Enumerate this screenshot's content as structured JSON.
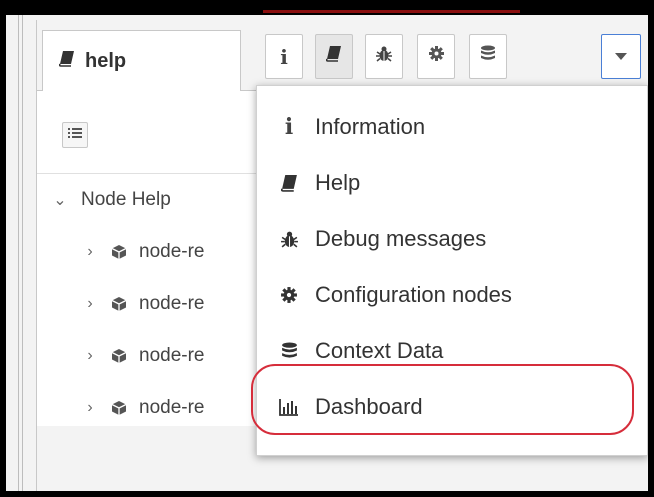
{
  "tabs": {
    "active_label": "help"
  },
  "toolbar": {
    "buttons": [
      {
        "icon": "info-icon"
      },
      {
        "icon": "book-icon"
      },
      {
        "icon": "bug-icon"
      },
      {
        "icon": "gear-icon"
      },
      {
        "icon": "database-icon"
      },
      {
        "icon": "caret-down-icon"
      }
    ]
  },
  "tree": {
    "root_label": "Node Help",
    "items": [
      {
        "label": "node-re"
      },
      {
        "label": "node-re"
      },
      {
        "label": "node-re"
      },
      {
        "label": "node-re"
      }
    ]
  },
  "menu": {
    "items": [
      {
        "label": "Information",
        "icon": "info-icon"
      },
      {
        "label": "Help",
        "icon": "book-icon"
      },
      {
        "label": "Debug messages",
        "icon": "bug-icon"
      },
      {
        "label": "Configuration nodes",
        "icon": "gear-icon"
      },
      {
        "label": "Context Data",
        "icon": "database-icon"
      },
      {
        "label": "Dashboard",
        "icon": "bar-chart-icon"
      }
    ],
    "highlighted_item": "Dashboard"
  },
  "colors": {
    "highlight_ring": "#d62d3b",
    "dropdown_focus": "#4a7fd6",
    "top_accent": "#8a0f0f"
  }
}
